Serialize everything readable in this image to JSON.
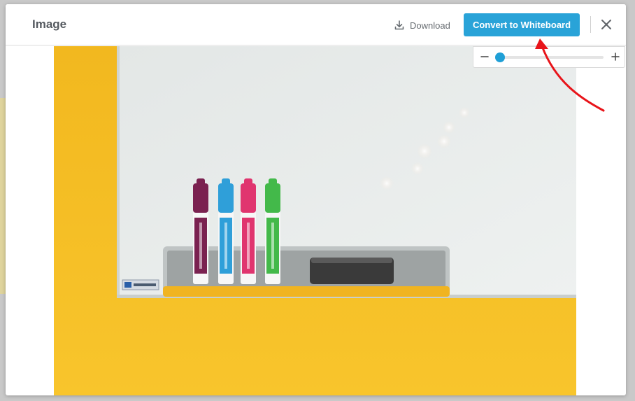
{
  "dialog": {
    "title": "Image",
    "download_label": "Download",
    "convert_label": "Convert to Whiteboard",
    "close_icon": "close-icon",
    "download_icon": "download-icon"
  },
  "image": {
    "description_icon": "whiteboard-photo",
    "marker_colors": [
      "#7a2150",
      "#2f9fd9",
      "#e0356f",
      "#43b94a"
    ],
    "board_brand_colors": [
      "#ffffff",
      "#2a5fa8"
    ],
    "background_color": "#f6bf2a",
    "board_color": "#e7ebe9"
  },
  "zoom": {
    "minus_icon": "minus-icon",
    "plus_icon": "plus-icon",
    "level": 0.0
  },
  "annotation": {
    "arrow_color": "#e8141a"
  },
  "colors": {
    "accent": "#29a3d8"
  }
}
